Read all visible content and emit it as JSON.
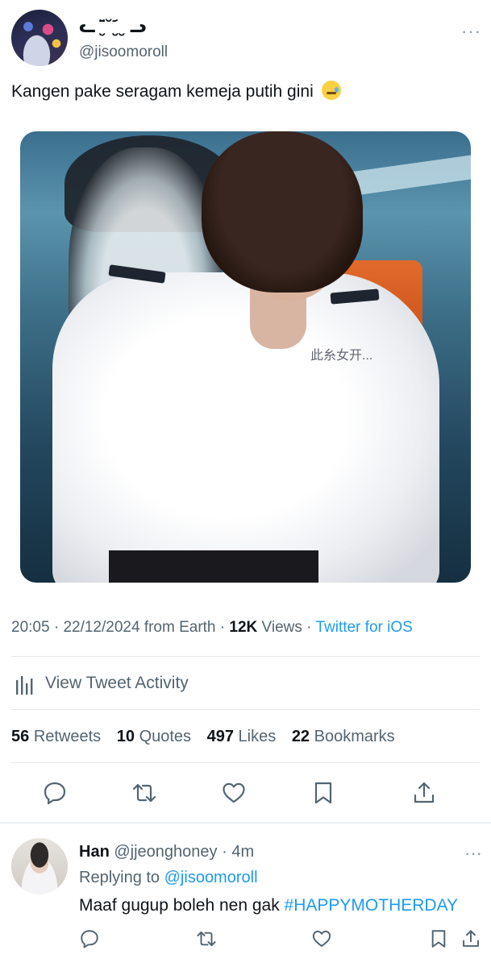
{
  "tweet": {
    "display_name": "ᓚ ̮᷄᷅ ̆ ̮᷄ ̮ ᓗ",
    "handle": "@jisoomoroll",
    "more_label": "···",
    "text": "Kangen pake seragam kemeja putih gini",
    "emoji_name": "face-holding-back-tears",
    "photo_watermark": "此糸女开...",
    "time": "20:05",
    "date": "22/12/2024",
    "location_prefix": "from Earth",
    "views_count": "12K",
    "views_label": "Views",
    "source": "Twitter for iOS",
    "activity_label": "View Tweet Activity",
    "stats": [
      {
        "count": "56",
        "label": "Retweets"
      },
      {
        "count": "10",
        "label": "Quotes"
      },
      {
        "count": "497",
        "label": "Likes"
      },
      {
        "count": "22",
        "label": "Bookmarks"
      }
    ],
    "actions": [
      "reply-icon",
      "retweet-icon",
      "like-icon",
      "bookmark-icon",
      "share-icon"
    ]
  },
  "reply": {
    "name": "Han",
    "handle": "@jjeonghoney",
    "time": "4m",
    "replying_prefix": "Replying to",
    "replying_to": "@jisoomoroll",
    "text": "Maaf gugup boleh nen gak",
    "hashtag": "#HAPPYMOTHERDAY",
    "more_label": "···"
  },
  "colors": {
    "accent": "#1d9bf0",
    "secondary_text": "#536471",
    "primary_text": "#0f1419"
  }
}
